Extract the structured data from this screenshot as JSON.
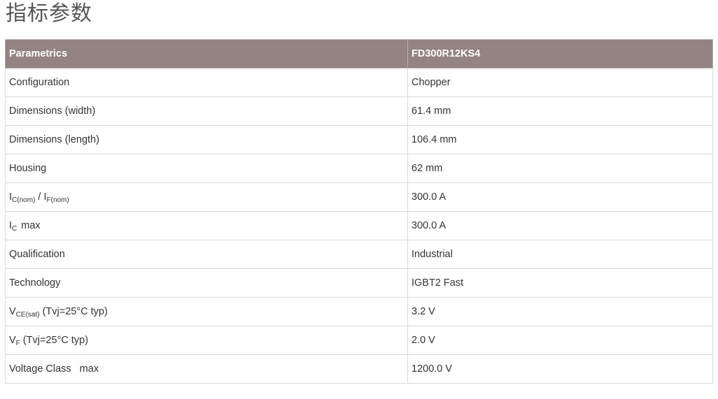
{
  "page": {
    "title": "指标参数"
  },
  "table": {
    "headers": [
      "Parametrics",
      "FD300R12KS4"
    ],
    "rows": [
      {
        "param": "Configuration",
        "value": "Chopper"
      },
      {
        "param": "Dimensions (width)",
        "value": "61.4 mm"
      },
      {
        "param": "Dimensions (length)",
        "value": "106.4 mm"
      },
      {
        "param": "Housing",
        "value": "62 mm"
      },
      {
        "param_parts": {
          "a": "I",
          "a_sub": "C(nom)",
          "sep": " / ",
          "b": "I",
          "b_sub": "F(nom)"
        },
        "value": "300.0 A"
      },
      {
        "param_parts": {
          "a": "I",
          "a_sub": "C",
          "rest": "max"
        },
        "value": "300.0 A"
      },
      {
        "param": "Qualification",
        "value": "Industrial"
      },
      {
        "param": "Technology",
        "value": "IGBT2 Fast"
      },
      {
        "param_parts": {
          "a": "V",
          "a_sub": "CE(sat)",
          "rest": " (Tvj=25°C typ)"
        },
        "value": "3.2 V"
      },
      {
        "param_parts": {
          "a": "V",
          "a_sub": "F",
          "rest": " (Tvj=25°C typ)"
        },
        "value": "2.0 V"
      },
      {
        "param_parts": {
          "a": "Voltage Class",
          "rest": "max"
        },
        "value": "1200.0 V"
      }
    ]
  }
}
